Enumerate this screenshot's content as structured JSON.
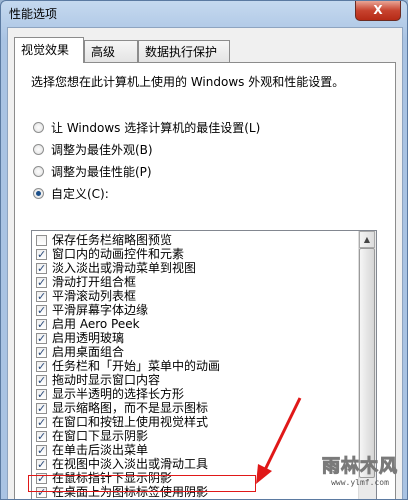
{
  "window": {
    "title": "性能选项",
    "close_label": "X"
  },
  "tabs": [
    {
      "label": "视觉效果",
      "active": true
    },
    {
      "label": "高级",
      "active": false
    },
    {
      "label": "数据执行保护",
      "active": false
    }
  ],
  "panel": {
    "description": "选择您想在此计算机上使用的 Windows 外观和性能设置。",
    "radios": [
      {
        "label": "让 Windows 选择计算机的最佳设置(L)",
        "checked": false
      },
      {
        "label": "调整为最佳外观(B)",
        "checked": false
      },
      {
        "label": "调整为最佳性能(P)",
        "checked": false
      },
      {
        "label": "自定义(C):",
        "checked": true
      }
    ],
    "options": [
      {
        "label": "保存任务栏缩略图预览",
        "checked": false
      },
      {
        "label": "窗口内的动画控件和元素",
        "checked": true
      },
      {
        "label": "淡入淡出或滑动菜单到视图",
        "checked": true
      },
      {
        "label": "滑动打开组合框",
        "checked": true
      },
      {
        "label": "平滑滚动列表框",
        "checked": true
      },
      {
        "label": "平滑屏幕字体边缘",
        "checked": true
      },
      {
        "label": "启用 Aero Peek",
        "checked": true
      },
      {
        "label": "启用透明玻璃",
        "checked": true
      },
      {
        "label": "启用桌面组合",
        "checked": true
      },
      {
        "label": "任务栏和「开始」菜单中的动画",
        "checked": true
      },
      {
        "label": "拖动时显示窗口内容",
        "checked": true
      },
      {
        "label": "显示半透明的选择长方形",
        "checked": true
      },
      {
        "label": "显示缩略图，而不是显示图标",
        "checked": true
      },
      {
        "label": "在窗口和按钮上使用视觉样式",
        "checked": true
      },
      {
        "label": "在窗口下显示阴影",
        "checked": true
      },
      {
        "label": "在单击后淡出菜单",
        "checked": true
      },
      {
        "label": "在视图中淡入淡出或滑动工具",
        "checked": true
      },
      {
        "label": "在鼠标指针下显示阴影",
        "checked": true
      },
      {
        "label": "在桌面上为图标标签使用阴影",
        "checked": true
      }
    ]
  },
  "watermark": {
    "main": "雨林木风",
    "sub": "www.ylmf.com"
  },
  "colors": {
    "highlight_box": "#e01818",
    "arrow": "#e01818",
    "radio_dot": "#1b4f8a"
  }
}
